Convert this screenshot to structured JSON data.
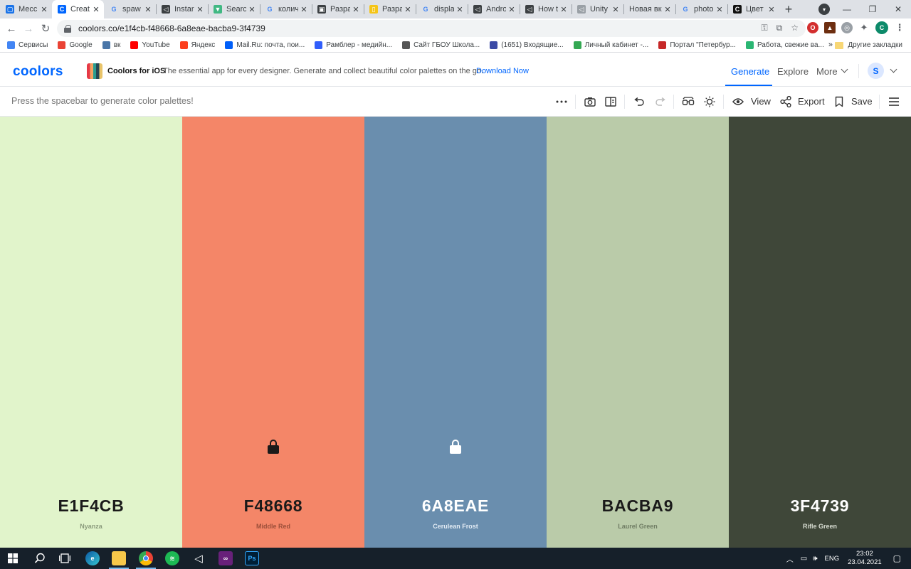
{
  "browser": {
    "tabs": [
      {
        "title": "Месс",
        "favicon_color": "#1a73e8",
        "favicon_glyph": "▢"
      },
      {
        "title": "Creat",
        "favicon_color": "#0066ff",
        "favicon_glyph": "C",
        "active": true
      },
      {
        "title": "spaw",
        "favicon_color": "#ffffff",
        "favicon_glyph": "G"
      },
      {
        "title": "Instar",
        "favicon_color": "#3c4043",
        "favicon_glyph": "◁"
      },
      {
        "title": "Searc",
        "favicon_color": "#41b883",
        "favicon_glyph": "▼"
      },
      {
        "title": "колич",
        "favicon_color": "#ffffff",
        "favicon_glyph": "G"
      },
      {
        "title": "Разра",
        "favicon_color": "#3c4043",
        "favicon_glyph": "▣"
      },
      {
        "title": "Разра",
        "favicon_color": "#f5c518",
        "favicon_glyph": "▯"
      },
      {
        "title": "displa",
        "favicon_color": "#ffffff",
        "favicon_glyph": "G"
      },
      {
        "title": "Andro",
        "favicon_color": "#3c4043",
        "favicon_glyph": "◁"
      },
      {
        "title": "How t",
        "favicon_color": "#3c4043",
        "favicon_glyph": "◁"
      },
      {
        "title": "Unity",
        "favicon_color": "#9aa0a6",
        "favicon_glyph": "◁"
      },
      {
        "title": "Новая вк",
        "favicon_color": "",
        "favicon_glyph": ""
      },
      {
        "title": "photo",
        "favicon_color": "#ffffff",
        "favicon_glyph": "G"
      },
      {
        "title": "Цвет",
        "favicon_color": "#111111",
        "favicon_glyph": "C"
      }
    ],
    "url": "coolors.co/e1f4cb-f48668-6a8eae-bacba9-3f4739",
    "bookmarks": [
      {
        "label": "Сервисы",
        "color": "#4285f4"
      },
      {
        "label": "Google",
        "color": "#ea4335"
      },
      {
        "label": "вк",
        "color": "#4a76a8"
      },
      {
        "label": "YouTube",
        "color": "#ff0000"
      },
      {
        "label": "Яндекс",
        "color": "#fc3f1d"
      },
      {
        "label": "Mail.Ru: почта, пои...",
        "color": "#005ff9"
      },
      {
        "label": "Рамблер - медийн...",
        "color": "#315efb"
      },
      {
        "label": "Сайт ГБОУ Школа...",
        "color": "#555555"
      },
      {
        "label": "(1651) Входящие...",
        "color": "#3c4ba6"
      },
      {
        "label": "Личный кабинет -...",
        "color": "#34a853"
      },
      {
        "label": "Портал \"Петербур...",
        "color": "#c62828"
      },
      {
        "label": "Работа, свежие ва...",
        "color": "#2bb673"
      }
    ],
    "other_bookmarks": "Другие закладки"
  },
  "header": {
    "logo": "coolors",
    "ios_title": "Coolors for iOS",
    "ios_desc": "The essential app for every designer. Generate and collect beautiful color palettes on the go.",
    "ios_download": "Download Now",
    "nav": {
      "generate": "Generate",
      "explore": "Explore",
      "more": "More"
    },
    "avatar_letter": "S"
  },
  "toolbar": {
    "hint": "Press the spacebar to generate color palettes!",
    "view": "View",
    "export": "Export",
    "save": "Save"
  },
  "palette": [
    {
      "hex": "E1F4CB",
      "name": "Nyanza",
      "bg": "#e1f4cb",
      "text": "#1a1a1a",
      "sub": "#8a9a7c",
      "locked": false
    },
    {
      "hex": "F48668",
      "name": "Middle Red",
      "bg": "#f48668",
      "text": "#1a1a1a",
      "sub": "#9c4f3a",
      "locked": true
    },
    {
      "hex": "6A8EAE",
      "name": "Cerulean Frost",
      "bg": "#6a8eae",
      "text": "#ffffff",
      "sub": "#e2ebf4",
      "locked": true
    },
    {
      "hex": "BACBA9",
      "name": "Laurel Green",
      "bg": "#bacba9",
      "text": "#1a1a1a",
      "sub": "#6f7c63",
      "locked": false
    },
    {
      "hex": "3F4739",
      "name": "Rifle Green",
      "bg": "#3f4739",
      "text": "#ffffff",
      "sub": "#d7dcd1",
      "locked": false
    }
  ],
  "taskbar": {
    "language": "ENG",
    "time": "23:02",
    "date": "23.04.2021"
  }
}
